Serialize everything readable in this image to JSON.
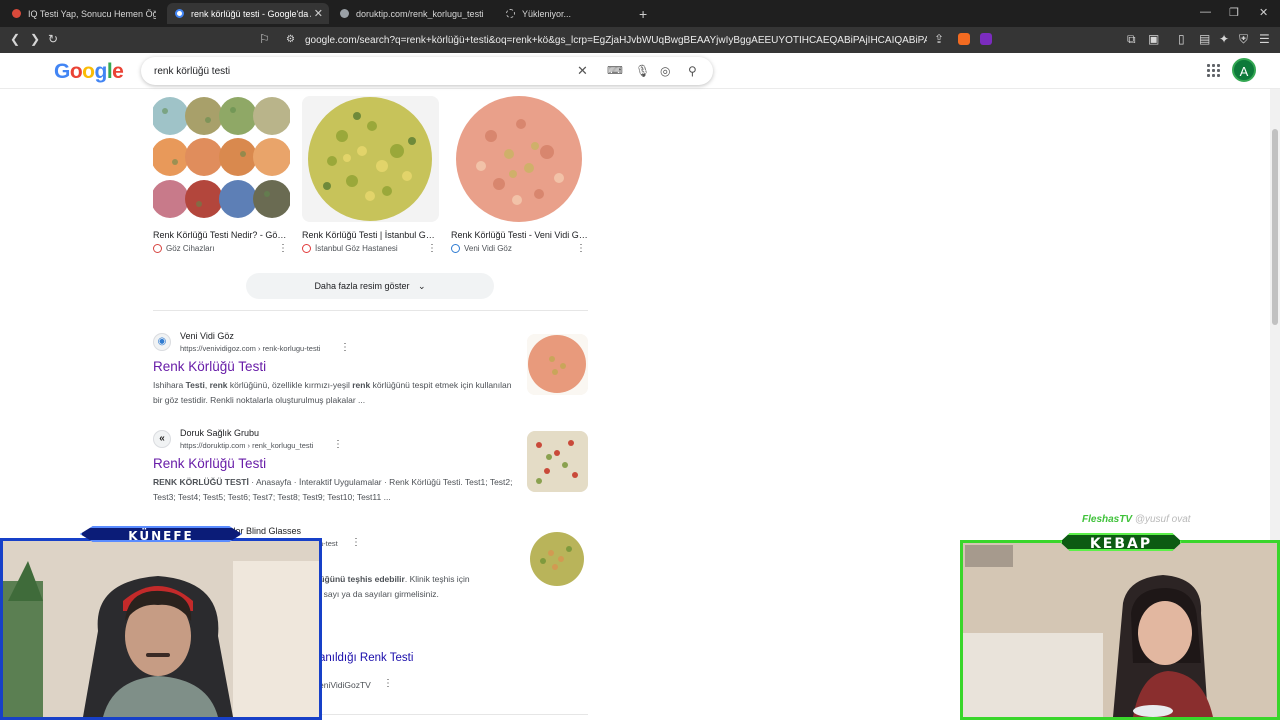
{
  "browser": {
    "tabs": [
      {
        "label": "IQ Testi Yap, Sonucu Hemen Öğren",
        "active": false
      },
      {
        "label": "renk körlüğü testi - Google'da Ara",
        "active": true
      },
      {
        "label": "doruktip.com/renk_korlugu_testi.htm",
        "active": false
      },
      {
        "label": "Yükleniyor...",
        "active": false
      }
    ],
    "url": "google.com/search?q=renk+körlüğü+testi&oq=renk+kö&gs_lcrp=EgZjaHJvbWUqBwgBEAAYjwIyBggAEEUYOTIHCAEQABiPAjIHCAIQABiPAjIHCAMQA..."
  },
  "search": {
    "query": "renk körlüğü testi"
  },
  "account": {
    "initial": "A"
  },
  "images": [
    {
      "caption": "Renk Körlüğü Testi Nedir? - Göz Cihazları",
      "source": "Göz Cihazları"
    },
    {
      "caption": "Renk Körlüğü Testi | İstanbul Göz Hastanesi",
      "source": "İstanbul Göz Hastanesi"
    },
    {
      "caption": "Renk Körlüğü Testi - Veni Vidi Göz",
      "source": "Veni Vidi Göz"
    }
  ],
  "more_images_label": "Daha fazla resim göster",
  "results": [
    {
      "site": "Veni Vidi Göz",
      "url": "https://venividigoz.com › renk-korlugu-testi",
      "title": "Renk Körlüğü Testi",
      "snippet_html": "Ishihara <b>Testi</b>, <b>renk</b> körlüğünü, özellikle kırmızı-yeşil <b>renk</b> körlüğünü tespit etmek için kullanılan bir göz testidir. Renkli noktalarla oluşturulmuş plakalar ..."
    },
    {
      "site": "Doruk Sağlık Grubu",
      "url": "https://doruktip.com › renk_korlugu_testi",
      "title": "Renk Körlüğü Testi",
      "snippet_html": "<b>RENK KÖRLÜĞÜ TESTİ</b> · Anasayfa · İnteraktif Uygulamalar · Renk Körlüğü Testi. Test1; Test2; Test3; Test4; Test5; Test6; Test7; Test8; Test9; Test10; Test11 ..."
    },
    {
      "site": "Color Blind Glasses",
      "url": "a-test",
      "snippet_a": "lüğünü teşhis edebilir",
      "snippet_b": ". Klinik teşhis için",
      "snippet_c": "z sayı ya da sayıları girmelisiniz."
    }
  ],
  "partial": {
    "title": "anıldığı Renk Testi",
    "source": "eniVidiGozTV"
  },
  "overlay": {
    "left_badge": "KÜNEFE",
    "right_badge": "KEBAP",
    "handle_name": "FleshasTV",
    "handle_sub": "@yusuf ovat"
  }
}
